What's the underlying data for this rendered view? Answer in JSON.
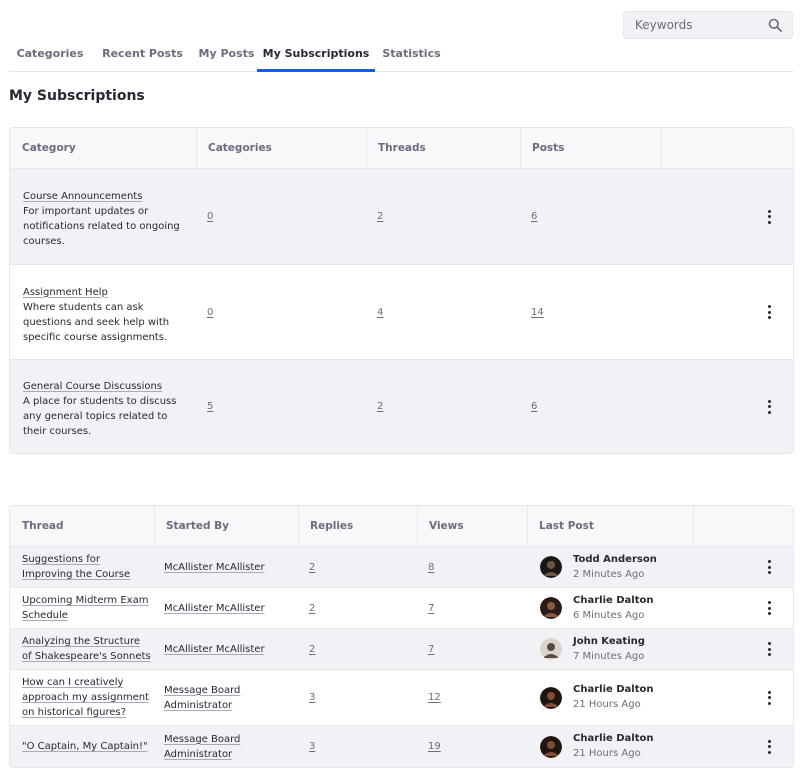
{
  "search": {
    "placeholder": "Keywords"
  },
  "tabs": [
    {
      "label": "Categories"
    },
    {
      "label": "Recent Posts"
    },
    {
      "label": "My Posts"
    },
    {
      "label": "My Subscriptions",
      "active": true
    },
    {
      "label": "Statistics"
    }
  ],
  "page_title": "My Subscriptions",
  "categories_table": {
    "headers": [
      "Category",
      "Categories",
      "Threads",
      "Posts"
    ],
    "rows": [
      {
        "name": "Course Announcements",
        "description": "For important updates or notifications related to ongoing courses.",
        "categories": "0",
        "threads": "2",
        "posts": "6"
      },
      {
        "name": "Assignment Help",
        "description": "Where students can ask questions and seek help with specific course assignments.",
        "categories": "0",
        "threads": "4",
        "posts": "14"
      },
      {
        "name": "General Course Discussions",
        "description": "A place for students to discuss any general topics related to their courses.",
        "categories": "5",
        "threads": "2",
        "posts": "6"
      }
    ]
  },
  "threads_table": {
    "headers": [
      "Thread",
      "Started By",
      "Replies",
      "Views",
      "Last Post"
    ],
    "rows": [
      {
        "thread": "Suggestions for Improving the Course",
        "started_by": "McAllister McAllister",
        "replies": "2",
        "views": "8",
        "last_post_user": "Todd Anderson",
        "last_post_time": "2 Minutes Ago",
        "avatar_icon": "user-avatar"
      },
      {
        "thread": "Upcoming Midterm Exam Schedule",
        "started_by": "McAllister McAllister",
        "replies": "2",
        "views": "7",
        "last_post_user": "Charlie Dalton",
        "last_post_time": "6 Minutes Ago",
        "avatar_icon": "user-avatar"
      },
      {
        "thread": "Analyzing the Structure of Shakespeare's Sonnets",
        "started_by": "McAllister McAllister",
        "replies": "2",
        "views": "7",
        "last_post_user": "John Keating",
        "last_post_time": "7 Minutes Ago",
        "avatar_icon": "user-avatar"
      },
      {
        "thread": "How can I creatively approach my assignment on historical figures?",
        "started_by": "Message Board Administrator",
        "replies": "3",
        "views": "12",
        "last_post_user": "Charlie Dalton",
        "last_post_time": "21 Hours Ago",
        "avatar_icon": "user-avatar"
      },
      {
        "thread": "\"O Captain, My Captain!\"",
        "started_by": "Message Board Administrator",
        "replies": "3",
        "views": "19",
        "last_post_user": "Charlie Dalton",
        "last_post_time": "21 Hours Ago",
        "avatar_icon": "user-avatar"
      }
    ]
  },
  "colors": {
    "accent": "#0b5fff",
    "text": "#272833",
    "muted": "#6b6c7e",
    "row_alt": "#f1f2f5",
    "border": "#e7e7ed"
  }
}
